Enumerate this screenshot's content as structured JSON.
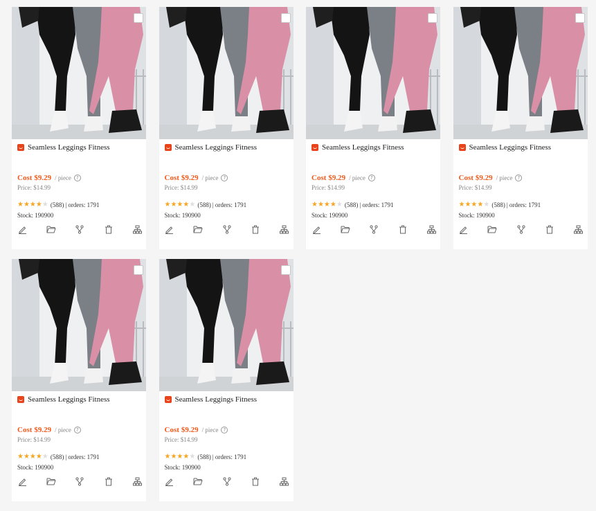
{
  "products": [
    {
      "title": "Seamless Leggings Fitness",
      "cost_label": "Cost",
      "cost": "$9.29",
      "unit": "/ piece",
      "price": "Price: $14.99",
      "rating": 4,
      "reviews": "(588)",
      "orders": "| orders: 1791",
      "stock": "Stock: 190900"
    },
    {
      "title": "Seamless Leggings Fitness",
      "cost_label": "Cost",
      "cost": "$9.29",
      "unit": "/ piece",
      "price": "Price: $14.99",
      "rating": 4,
      "reviews": "(588)",
      "orders": "| orders: 1791",
      "stock": "Stock: 190900"
    },
    {
      "title": "Seamless Leggings Fitness",
      "cost_label": "Cost",
      "cost": "$9.29",
      "unit": "/ piece",
      "price": "Price: $14.99",
      "rating": 4,
      "reviews": "(588)",
      "orders": "| orders: 1791",
      "stock": "Stock: 190900"
    },
    {
      "title": "Seamless Leggings Fitness",
      "cost_label": "Cost",
      "cost": "$9.29",
      "unit": "/ piece",
      "price": "Price: $14.99",
      "rating": 4,
      "reviews": "(588)",
      "orders": "| orders: 1791",
      "stock": "Stock: 190900"
    },
    {
      "title": "Seamless Leggings Fitness",
      "cost_label": "Cost",
      "cost": "$9.29",
      "unit": "/ piece",
      "price": "Price: $14.99",
      "rating": 4,
      "reviews": "(588)",
      "orders": "| orders: 1791",
      "stock": "Stock: 190900"
    },
    {
      "title": "Seamless Leggings Fitness",
      "cost_label": "Cost",
      "cost": "$9.29",
      "unit": "/ piece",
      "price": "Price: $14.99",
      "rating": 4,
      "reviews": "(588)",
      "orders": "| orders: 1791",
      "stock": "Stock: 190900"
    }
  ],
  "actions": [
    "edit-icon",
    "folder-icon",
    "branch-icon",
    "trash-icon",
    "sitemap-icon"
  ],
  "colors": {
    "accent": "#f2591b",
    "star": "#f5a623",
    "legging_black": "#141414",
    "legging_gray": "#7b7f86",
    "legging_pink": "#d98fa6"
  }
}
